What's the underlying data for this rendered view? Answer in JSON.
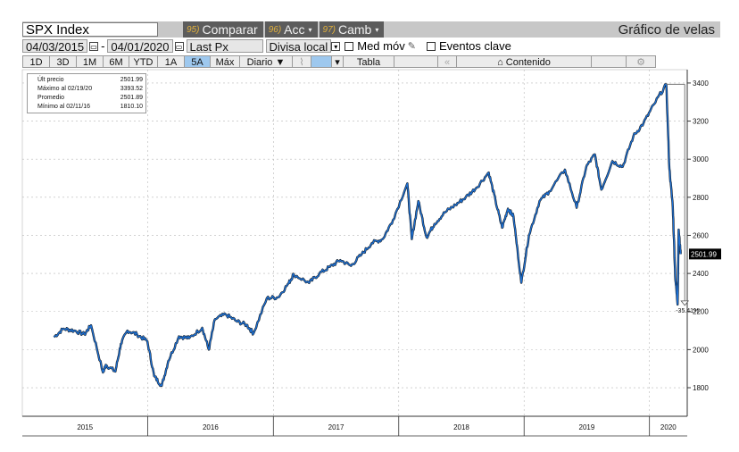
{
  "toolbar": {
    "ticker": "SPX Index",
    "menus": [
      {
        "num": "95)",
        "label": "Comparar",
        "caret": ""
      },
      {
        "num": "96)",
        "label": "Acc",
        "caret": "▾"
      },
      {
        "num": "97)",
        "label": "Camb",
        "caret": "▾"
      }
    ],
    "chart_title": "Gráfico de velas"
  },
  "params": {
    "start_date": "04/03/2015",
    "end_date": "04/01/2020",
    "field": "Last Px",
    "currency": "Divisa local",
    "moving_avg": "Med móv",
    "events": "Eventos clave"
  },
  "periods": [
    "1D",
    "3D",
    "1M",
    "6M",
    "YTD",
    "1A",
    "5A",
    "Máx"
  ],
  "active_period": "5A",
  "frequency": "Diario ▼",
  "table_label": "Tabla",
  "content_label": "Contenido",
  "legend": [
    {
      "label": "Últ precio",
      "value": "2501.99"
    },
    {
      "label": "Máximo al 02/19/20",
      "value": "3393.52"
    },
    {
      "label": "Promedio",
      "value": "2501.89"
    },
    {
      "label": "Mínimo al 02/11/16",
      "value": "1810.10"
    }
  ],
  "colors": {
    "up": "#1d6fd1",
    "down": "#111111",
    "last_tag_bg": "#000000",
    "active_tab": "#9ec8ee"
  },
  "chart_data": {
    "type": "line",
    "title": "",
    "xlabel": "",
    "ylabel": "",
    "ylim": [
      1650,
      3470
    ],
    "y_ticks": [
      1800,
      2000,
      2200,
      2400,
      2600,
      2800,
      3000,
      3200,
      3400
    ],
    "x_ticks": [
      "2015",
      "2016",
      "2017",
      "2018",
      "2019",
      "2020"
    ],
    "grid": true,
    "y_axis_position": "right",
    "last_value_label": "2501.99",
    "drawdown_label": "-35.41%",
    "series": [
      {
        "name": "SPX Index",
        "x": [
          "2015-04-03",
          "2015-05-01",
          "2015-06-01",
          "2015-07-01",
          "2015-07-20",
          "2015-08-24",
          "2015-09-01",
          "2015-09-29",
          "2015-10-15",
          "2015-11-03",
          "2015-12-01",
          "2015-12-31",
          "2016-01-20",
          "2016-02-11",
          "2016-03-01",
          "2016-04-01",
          "2016-05-01",
          "2016-06-08",
          "2016-06-27",
          "2016-07-15",
          "2016-08-15",
          "2016-09-15",
          "2016-10-15",
          "2016-11-04",
          "2016-12-13",
          "2017-01-15",
          "2017-02-15",
          "2017-03-01",
          "2017-04-15",
          "2017-05-15",
          "2017-06-15",
          "2017-07-15",
          "2017-08-15",
          "2017-09-15",
          "2017-10-15",
          "2017-11-15",
          "2017-12-15",
          "2018-01-26",
          "2018-02-08",
          "2018-02-27",
          "2018-03-23",
          "2018-04-15",
          "2018-05-15",
          "2018-06-15",
          "2018-07-15",
          "2018-08-15",
          "2018-09-20",
          "2018-10-10",
          "2018-10-29",
          "2018-11-15",
          "2018-12-01",
          "2018-12-24",
          "2019-01-15",
          "2019-02-15",
          "2019-03-15",
          "2019-04-30",
          "2019-06-03",
          "2019-07-01",
          "2019-07-26",
          "2019-08-14",
          "2019-09-15",
          "2019-10-15",
          "2019-11-15",
          "2019-12-15",
          "2020-01-15",
          "2020-02-19",
          "2020-02-28",
          "2020-03-09",
          "2020-03-16",
          "2020-03-23",
          "2020-03-26",
          "2020-04-01"
        ],
        "values": [
          2066,
          2110,
          2100,
          2080,
          2128,
          1880,
          1920,
          1885,
          2030,
          2100,
          2080,
          2044,
          1860,
          1810,
          1940,
          2070,
          2060,
          2115,
          2000,
          2160,
          2185,
          2150,
          2130,
          2085,
          2270,
          2275,
          2350,
          2395,
          2350,
          2400,
          2435,
          2470,
          2440,
          2500,
          2560,
          2580,
          2680,
          2873,
          2580,
          2780,
          2590,
          2660,
          2720,
          2760,
          2800,
          2850,
          2930,
          2780,
          2640,
          2740,
          2700,
          2351,
          2600,
          2780,
          2830,
          2945,
          2745,
          2960,
          3025,
          2840,
          2990,
          2960,
          3120,
          3190,
          3290,
          3393,
          2950,
          2750,
          2386,
          2237,
          2630,
          2501.99
        ]
      }
    ]
  }
}
